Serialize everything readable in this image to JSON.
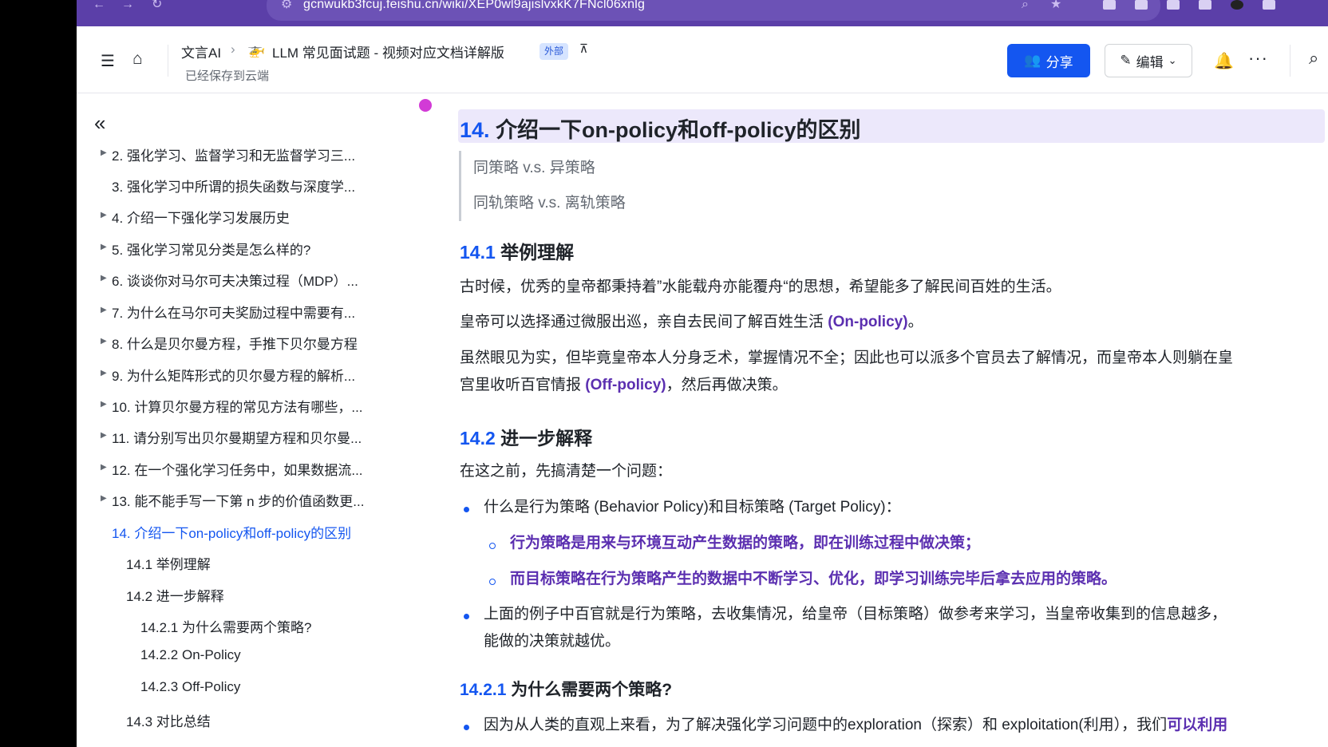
{
  "browser": {
    "url": "gcnwukb3fcuj.feishu.cn/wiki/XEP0wl9ajislvxkK7FNcl06xnlg"
  },
  "header": {
    "workspace": "文言AI",
    "doc_title": "LLM 常见面试题 - 视频对应文档详解版",
    "external_badge": "外部",
    "saved_status": "已经保存到云端",
    "share_label": "分享",
    "edit_label": "编辑"
  },
  "toc": {
    "items": [
      {
        "label": "2. 强化学习、监督学习和无监督学习三...",
        "arrow": true
      },
      {
        "label": "3. 强化学习中所谓的损失函数与深度学...",
        "arrow": false
      },
      {
        "label": "4. 介绍一下强化学习发展历史",
        "arrow": true
      },
      {
        "label": "5. 强化学习常见分类是怎么样的?",
        "arrow": true
      },
      {
        "label": "6. 谈谈你对马尔可夫决策过程（MDP）...",
        "arrow": true
      },
      {
        "label": "7. 为什么在马尔可夫奖励过程中需要有...",
        "arrow": true
      },
      {
        "label": "8. 什么是贝尔曼方程，手推下贝尔曼方程",
        "arrow": true
      },
      {
        "label": "9. 为什么矩阵形式的贝尔曼方程的解析...",
        "arrow": true
      },
      {
        "label": "10. 计算贝尔曼方程的常见方法有哪些，...",
        "arrow": true
      },
      {
        "label": "11. 请分别写出贝尔曼期望方程和贝尔曼...",
        "arrow": true
      },
      {
        "label": "12. 在一个强化学习任务中，如果数据流...",
        "arrow": true
      },
      {
        "label": "13. 能不能手写一下第 n 步的价值函数更...",
        "arrow": true
      },
      {
        "label": "14. 介绍一下on-policy和off-policy的区别",
        "arrow": false
      },
      {
        "label": "14.1 举例理解",
        "arrow": false
      },
      {
        "label": "14.2 进一步解释",
        "arrow": false
      },
      {
        "label": "14.2.1 为什么需要两个策略?",
        "arrow": false
      },
      {
        "label": "14.2.2 On-Policy",
        "arrow": false
      },
      {
        "label": "14.2.3 Off-Policy",
        "arrow": false
      },
      {
        "label": "14.3 对比总结",
        "arrow": false
      }
    ]
  },
  "content": {
    "h1_num": "14.",
    "h1_text": "介绍一下on-policy和off-policy的区别",
    "quote1": "同策略 v.s. 异策略",
    "quote2": "同轨策略 v.s. 离轨策略",
    "h2a_num": "14.1",
    "h2a_text": "举例理解",
    "p1": "古时候，优秀的皇帝都秉持着”水能载舟亦能覆舟“的思想，希望能多了解民间百姓的生活。",
    "p2_a": "皇帝可以选择通过微服出巡，亲自去民间了解百姓生活 ",
    "p2_b": "(On-policy)",
    "p2_c": "。",
    "p3_a": "虽然眼见为实，但毕竟皇帝本人分身乏术，掌握情况不全；因此也可以派多个官员去了解情况，而皇帝本人则躺在皇",
    "p3_b": "宫里收听百官情报 ",
    "p3_c": "(Off-policy)",
    "p3_d": "，然后再做决策。",
    "h2b_num": "14.2",
    "h2b_text": "进一步解释",
    "p4": "在这之前，先搞清楚一个问题：",
    "b1": "什么是行为策略 (Behavior Policy)和目标策略 (Target Policy)：",
    "b1_sub1": "行为策略是用来与环境互动产生数据的策略，即在训练过程中做决策；",
    "b1_sub2": "而目标策略在行为策略产生的数据中不断学习、优化，即学习训练完毕后拿去应用的策略。",
    "b2_line1": "上面的例子中百官就是行为策略，去收集情况，给皇帝（目标策略）做参考来学习，当皇帝收集到的信息越多，",
    "b2_line2": "能做的决策就越优。",
    "h3_num": "14.2.1",
    "h3_text": "为什么需要两个策略?",
    "b3_a": "因为从人类的直观上来看，为了解决强化学习问题中的exploration（探索）和 exploitation(利用），我们",
    "b3_b": "可以利用"
  },
  "colors": {
    "accent": "#1456f0",
    "purple": "#5b2fb0",
    "browser": "#5b3fa8"
  }
}
